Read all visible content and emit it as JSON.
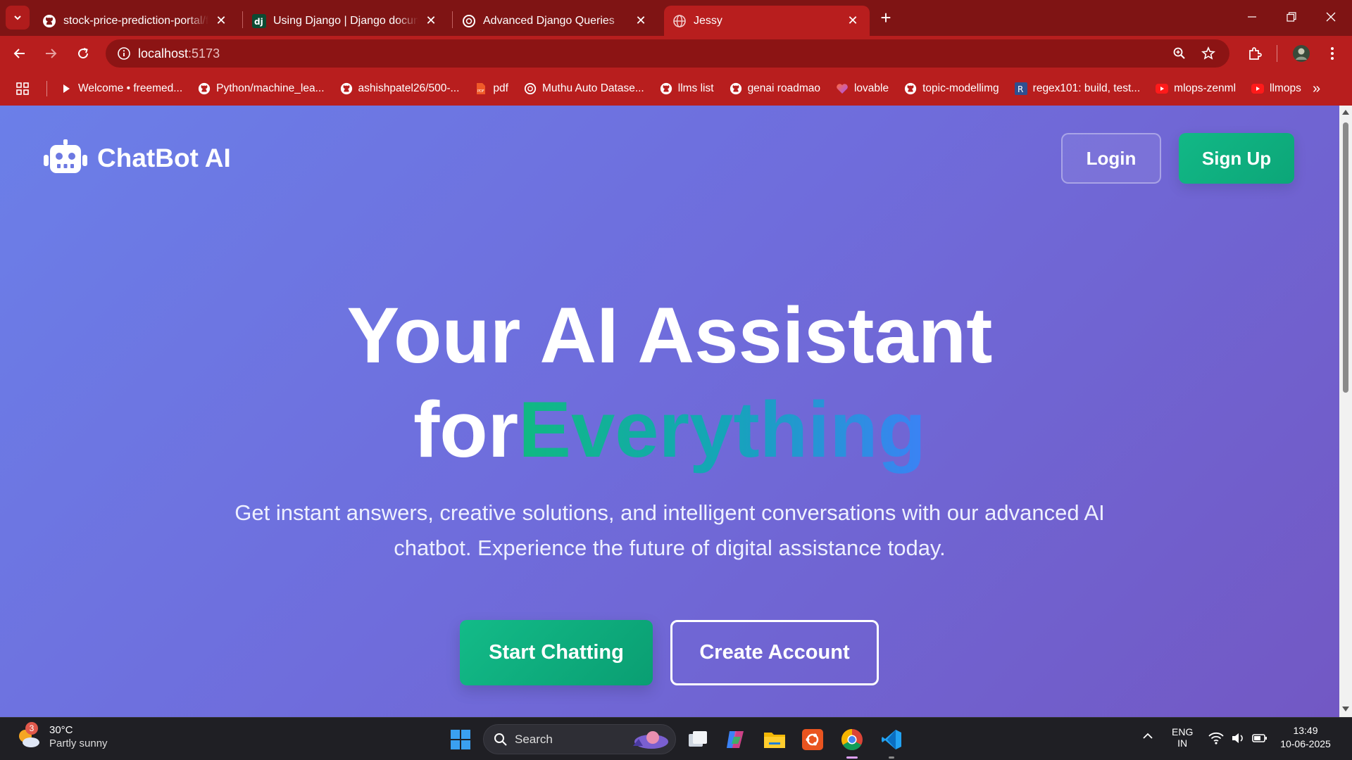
{
  "browser": {
    "tabs": [
      {
        "title": "stock-price-prediction-portal/fr",
        "icon": "github-icon"
      },
      {
        "title": "Using Django | Django docume",
        "icon": "django-icon"
      },
      {
        "title": "Advanced Django Queries",
        "icon": "openai-icon"
      },
      {
        "title": "Jessy",
        "icon": "globe-icon",
        "active": true
      }
    ],
    "url": "localhost",
    "url_port": ":5173",
    "bookmarks": [
      {
        "label": "Welcome • freemed...",
        "icon": "play-icon"
      },
      {
        "label": "Python/machine_lea...",
        "icon": "github-icon"
      },
      {
        "label": "ashishpatel26/500-...",
        "icon": "github-icon"
      },
      {
        "label": "pdf",
        "icon": "pdf-icon"
      },
      {
        "label": "Muthu Auto Datase...",
        "icon": "openai-icon"
      },
      {
        "label": "llms list",
        "icon": "github-icon"
      },
      {
        "label": "genai roadmao",
        "icon": "github-icon"
      },
      {
        "label": "lovable",
        "icon": "heart-icon"
      },
      {
        "label": "topic-modellimg",
        "icon": "github-icon"
      },
      {
        "label": "regex101: build, test...",
        "icon": "regex-icon"
      },
      {
        "label": "mlops-zenml",
        "icon": "youtube-icon"
      },
      {
        "label": "llmops",
        "icon": "youtube-icon"
      }
    ]
  },
  "page": {
    "brand": "ChatBot AI",
    "login": "Login",
    "signup": "Sign Up",
    "hero_line1": "Your AI Assistant",
    "hero_line2_a": "for",
    "hero_line2_b": "Everything",
    "subtitle": "Get instant answers, creative solutions, and intelligent conversations with our advanced AI chatbot. Experience the future of digital assistance today.",
    "cta_primary": "Start Chatting",
    "cta_secondary": "Create Account"
  },
  "taskbar": {
    "weather_temp": "30°C",
    "weather_desc": "Partly sunny",
    "weather_badge": "3",
    "search_placeholder": "Search",
    "lang": "ENG",
    "region": "IN",
    "time": "13:49",
    "date": "10-06-2025"
  },
  "colors": {
    "chrome": "#b81e1e",
    "tabstrip": "#7f1414",
    "accent_green": "#10b981",
    "accent_blue": "#3b82f6",
    "page_bg_start": "#6b7fe8",
    "page_bg_end": "#7258c4"
  }
}
